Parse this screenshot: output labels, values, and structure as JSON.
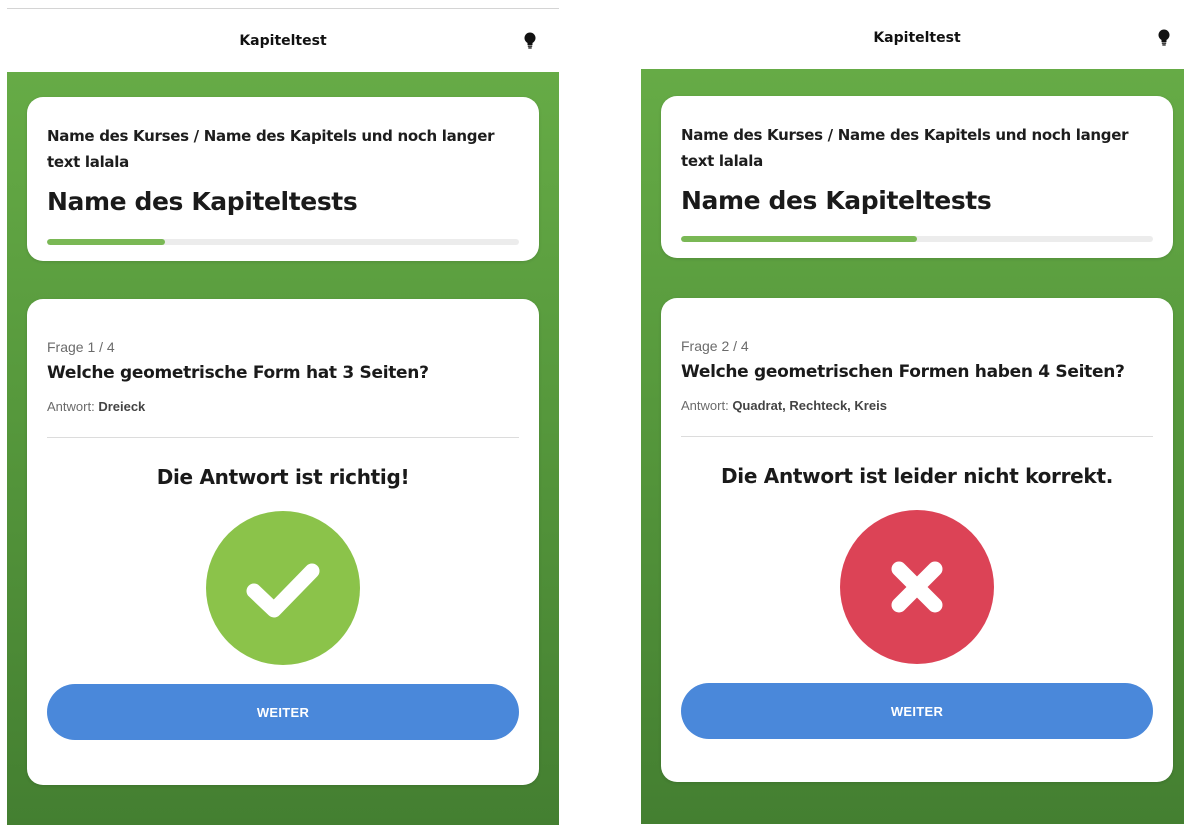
{
  "colors": {
    "progress": "#7ab855",
    "correct": "#8bc34a",
    "wrong": "#dc4356",
    "button": "#4a88da"
  },
  "screens": [
    {
      "header_title": "Kapiteltest",
      "header_icon": "lightbulb-icon",
      "breadcrumb": "Name des Kurses / Name des Kapitels und noch langer text lalala",
      "test_name": "Name des Kapiteltests",
      "progress_percent": 25,
      "question_counter": "Frage 1 / 4",
      "question": "Welche geometrische Form hat 3 Seiten?",
      "answer_label": "Antwort:",
      "answer_value": "Dreieck",
      "result_text": "Die Antwort ist richtig!",
      "result_icon": "checkmark-icon",
      "button_label": "WEITER"
    },
    {
      "header_title": "Kapiteltest",
      "header_icon": "lightbulb-icon",
      "breadcrumb": "Name des Kurses / Name des Kapitels und noch langer text lalala",
      "test_name": "Name des Kapiteltests",
      "progress_percent": 50,
      "question_counter": "Frage 2 / 4",
      "question": "Welche geometrischen Formen haben 4 Seiten?",
      "answer_label": "Antwort:",
      "answer_value": "Quadrat, Rechteck, Kreis",
      "result_text": "Die Antwort ist leider nicht korrekt.",
      "result_icon": "cross-icon",
      "button_label": "WEITER"
    }
  ]
}
